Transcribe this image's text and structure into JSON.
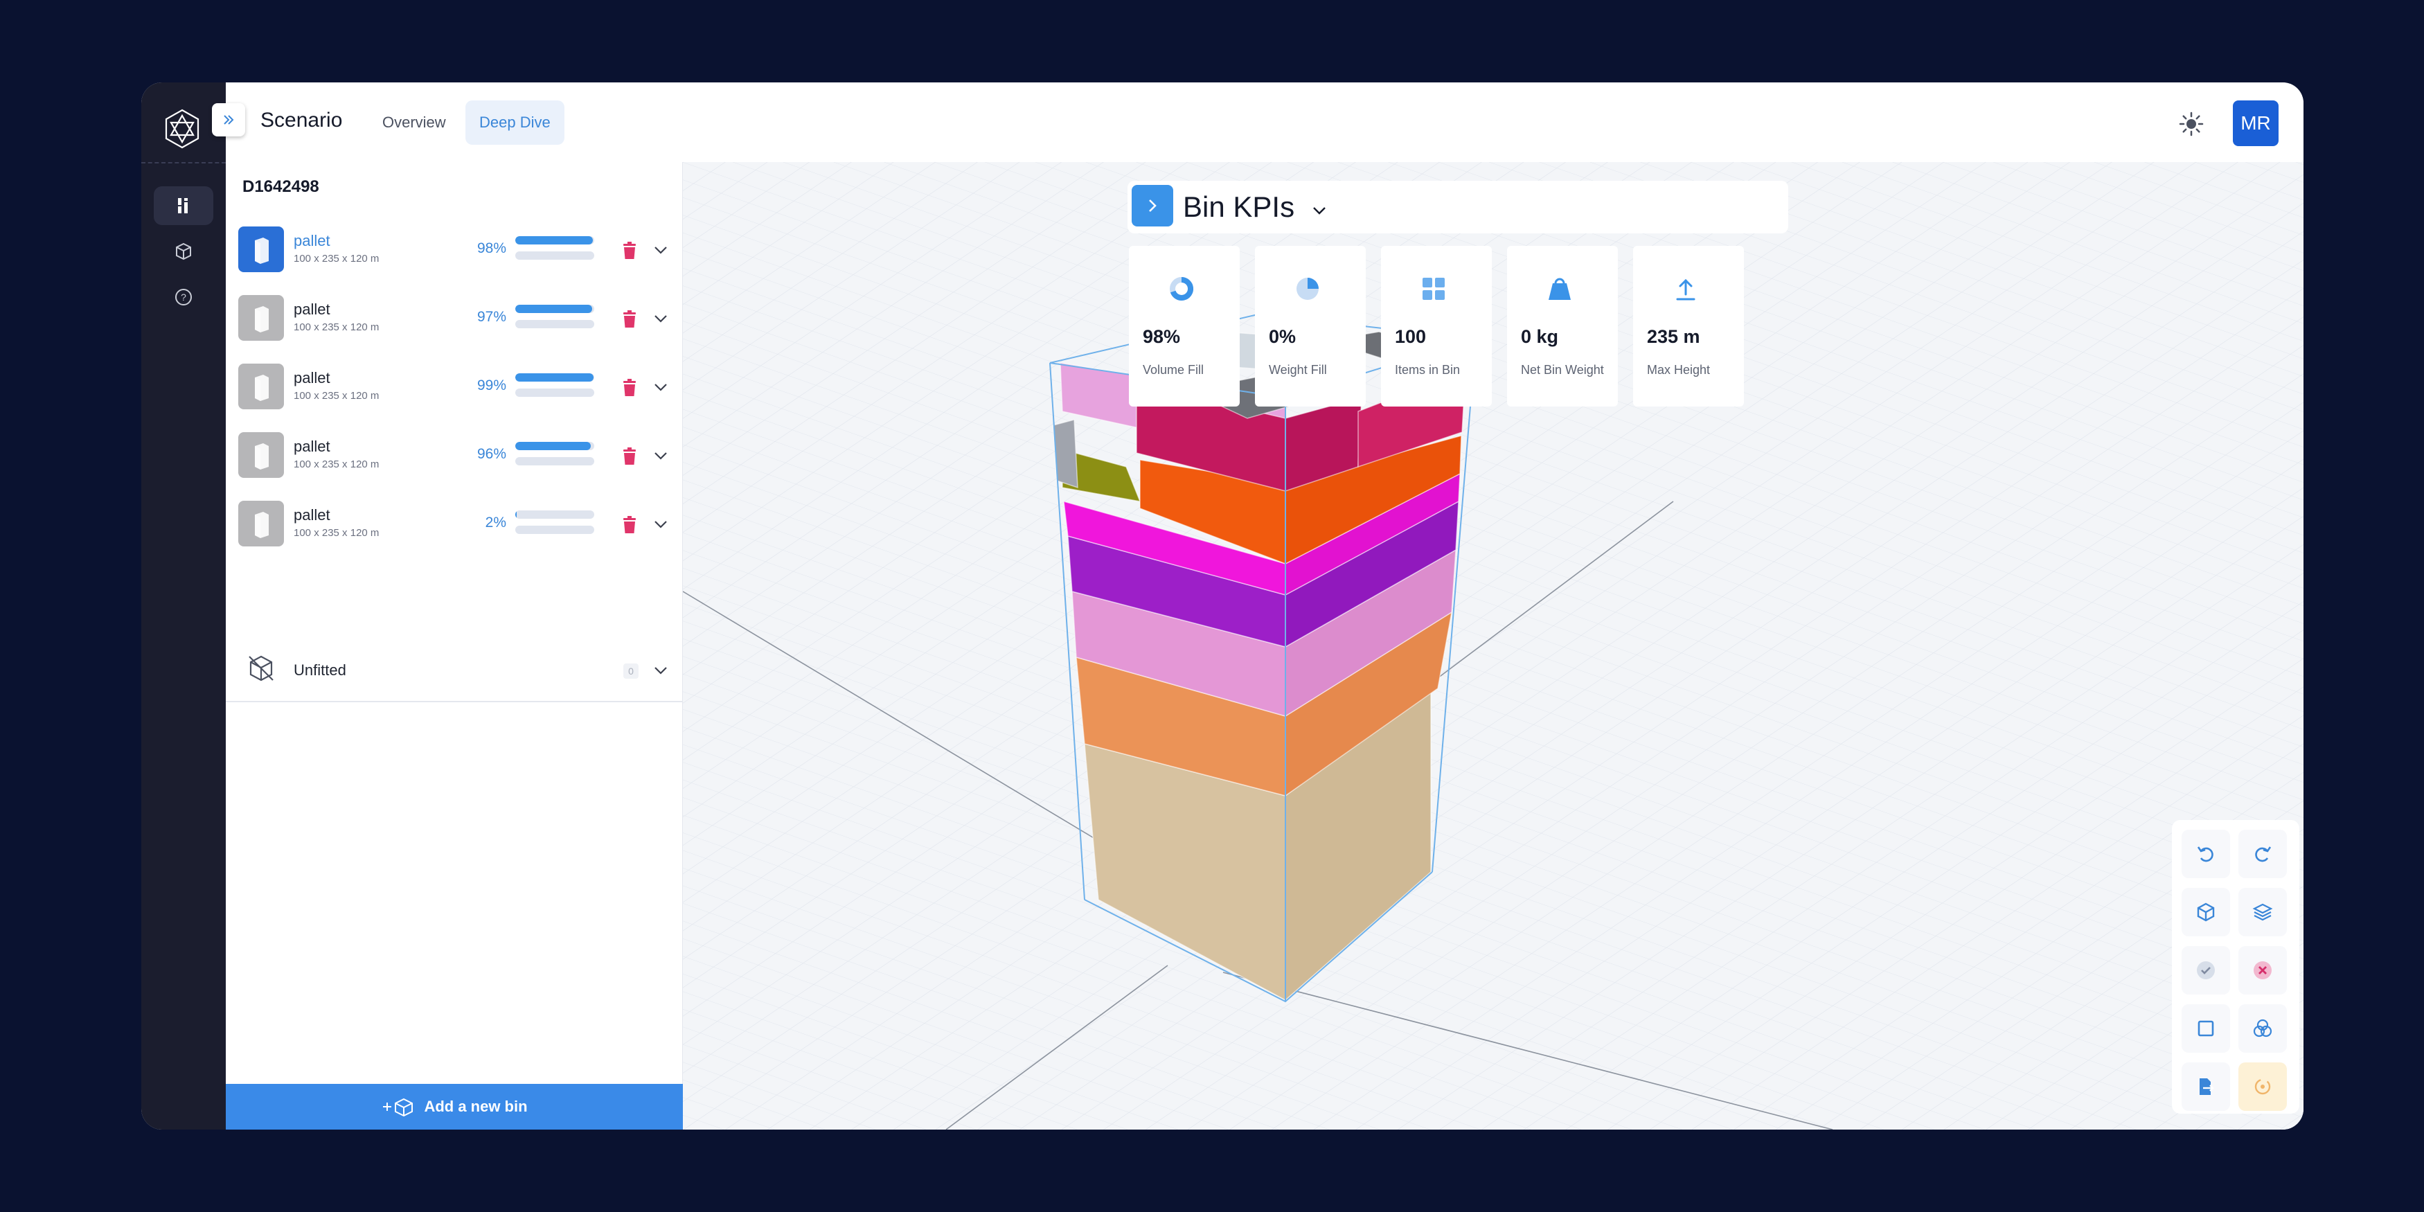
{
  "app": {
    "title": "Scenario",
    "avatar_initials": "MR"
  },
  "tabs": [
    {
      "label": "Overview",
      "active": false
    },
    {
      "label": "Deep Dive",
      "active": true
    }
  ],
  "rail": {
    "items": [
      "layers-icon",
      "box-icon",
      "help-icon"
    ]
  },
  "bins_panel": {
    "bin_id": "D1642498",
    "bins": [
      {
        "name": "pallet",
        "dims": "100 x 235 x 120 m",
        "volume_fill": "98%",
        "bar1": 0.98,
        "bar2": 0.0,
        "active": true
      },
      {
        "name": "pallet",
        "dims": "100 x 235 x 120 m",
        "volume_fill": "97%",
        "bar1": 0.97,
        "bar2": 0.0,
        "active": false
      },
      {
        "name": "pallet",
        "dims": "100 x 235 x 120 m",
        "volume_fill": "99%",
        "bar1": 0.99,
        "bar2": 0.0,
        "active": false
      },
      {
        "name": "pallet",
        "dims": "100 x 235 x 120 m",
        "volume_fill": "96%",
        "bar1": 0.96,
        "bar2": 0.0,
        "active": false
      },
      {
        "name": "pallet",
        "dims": "100 x 235 x 120 m",
        "volume_fill": "2%",
        "bar1": 0.02,
        "bar2": 0.0,
        "active": false
      }
    ],
    "unfitted": {
      "label": "Unfitted",
      "count": "0"
    },
    "add_bin_label": "Add a new bin"
  },
  "kpis": {
    "title": "Bin KPIs",
    "cards": [
      {
        "value": "98%",
        "label": "Volume Fill",
        "icon": "donut-chart-icon"
      },
      {
        "value": "0%",
        "label": "Weight Fill",
        "icon": "pie-chart-icon"
      },
      {
        "value": "100",
        "label": "Items in Bin",
        "icon": "grid-icon"
      },
      {
        "value": "0 kg",
        "label": "Net Bin Weight",
        "icon": "weight-icon"
      },
      {
        "value": "235 m",
        "label": "Max Height",
        "icon": "upload-arrow-icon"
      }
    ]
  },
  "tools": [
    "undo-icon",
    "redo-icon",
    "cube-icon",
    "layers-icon",
    "check-icon",
    "close-icon",
    "square-icon",
    "circles-icon",
    "export-icon",
    "reset-icon"
  ],
  "colors": {
    "accent": "#3a8ae8",
    "rail": "#1b1d2e",
    "background": "#0a1230",
    "delete": "#e0356a"
  }
}
